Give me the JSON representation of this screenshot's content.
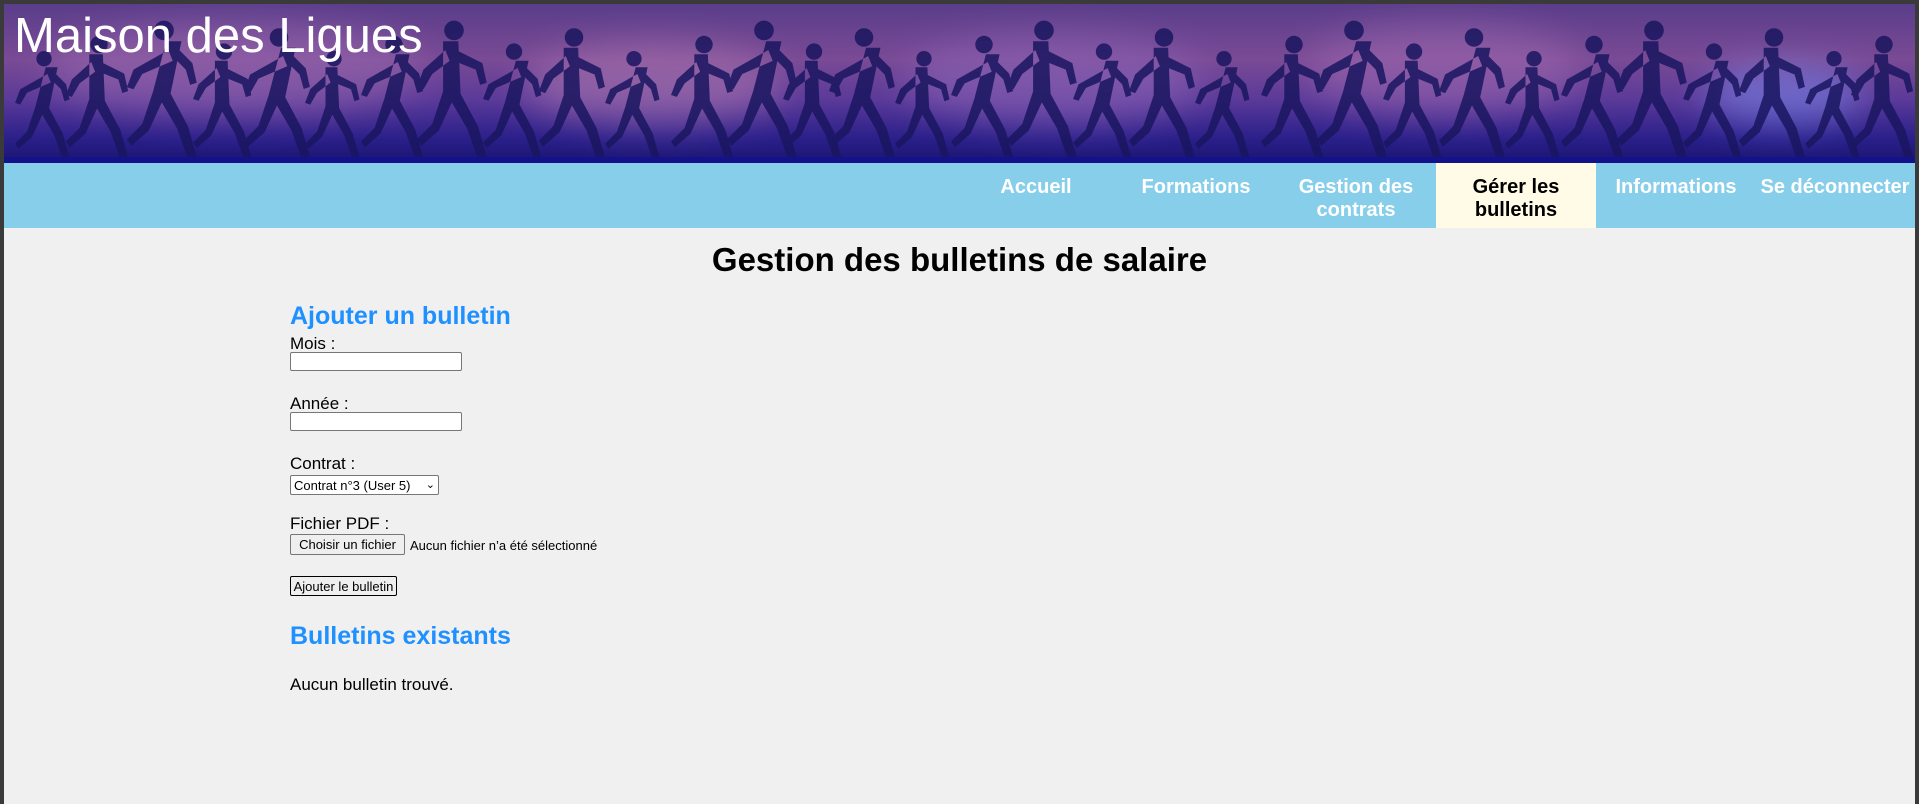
{
  "site": {
    "title": "Maison des Ligues"
  },
  "nav": {
    "items": [
      {
        "label": "Accueil"
      },
      {
        "label": "Formations"
      },
      {
        "label": "Gestion des contrats"
      },
      {
        "label": "Gérer les bulletins",
        "active": true
      },
      {
        "label": "Informations"
      },
      {
        "label": "Se déconnecter"
      }
    ]
  },
  "page": {
    "title": "Gestion des bulletins de salaire"
  },
  "add_form": {
    "title": "Ajouter un bulletin",
    "month_label": "Mois :",
    "month_value": "",
    "year_label": "Année :",
    "year_value": "",
    "contract_label": "Contrat :",
    "contract_selected": "Contrat n°3 (User 5)",
    "pdf_label": "Fichier PDF :",
    "file_button": "Choisir un fichier",
    "file_status": "Aucun fichier n’a été sélectionné",
    "submit_label": "Ajouter le bulletin"
  },
  "existing": {
    "title": "Bulletins existants",
    "empty_message": "Aucun bulletin trouvé."
  },
  "colors": {
    "nav_bg": "#87ceeb",
    "nav_active_bg": "#fffbe6",
    "section_title": "#1e90ff",
    "page_bg": "#f0f0f0"
  }
}
